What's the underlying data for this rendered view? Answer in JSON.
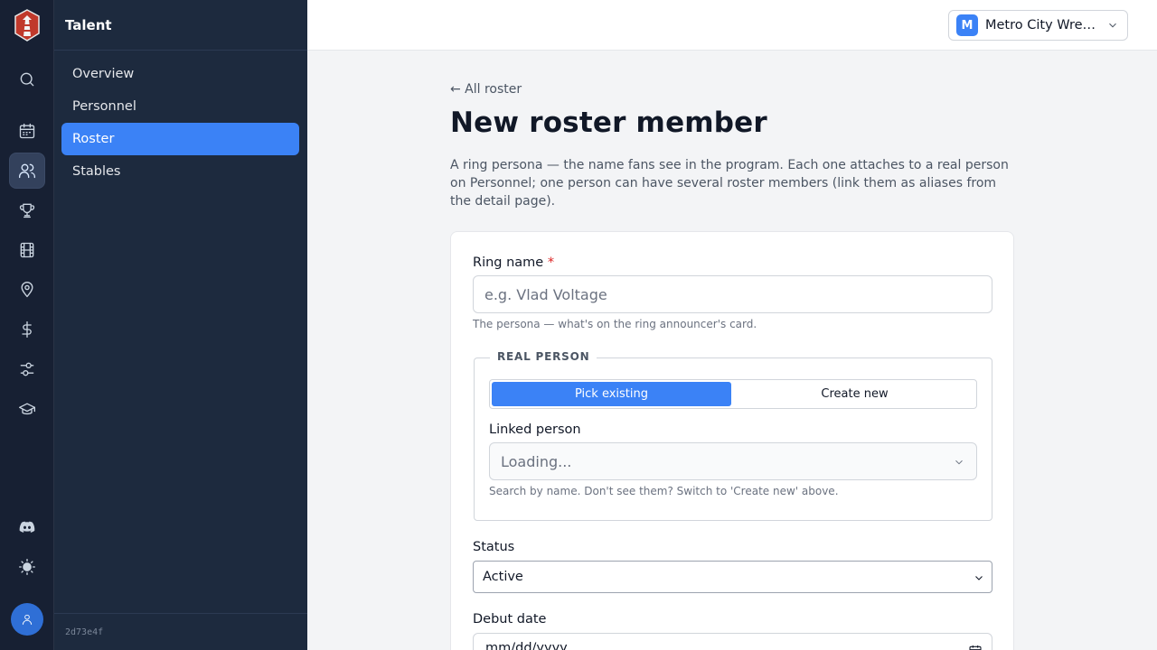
{
  "rail": {
    "logo_icon": "lighthouse-logo",
    "items": [
      {
        "icon": "search-icon",
        "active": false
      },
      {
        "icon": "calendar-icon",
        "active": false
      },
      {
        "icon": "users-icon",
        "active": true
      },
      {
        "icon": "trophy-icon",
        "active": false
      },
      {
        "icon": "film-icon",
        "active": false
      },
      {
        "icon": "map-pin-icon",
        "active": false
      },
      {
        "icon": "dollar-icon",
        "active": false
      },
      {
        "icon": "sliders-icon",
        "active": false
      },
      {
        "icon": "graduation-cap-icon",
        "active": false
      },
      {
        "icon": "discord-icon",
        "active": false
      },
      {
        "icon": "sun-icon",
        "active": false
      }
    ],
    "avatar_icon": "user-icon"
  },
  "subnav": {
    "title": "Talent",
    "items": [
      {
        "label": "Overview",
        "active": false
      },
      {
        "label": "Personnel",
        "active": false
      },
      {
        "label": "Roster",
        "active": true
      },
      {
        "label": "Stables",
        "active": false
      }
    ],
    "build_hash": "2d73e4f"
  },
  "topbar": {
    "org_initial": "M",
    "org_name": "Metro City Wrestling",
    "accent": "#3b82f6"
  },
  "page": {
    "back_link": "← All roster",
    "title": "New roster member",
    "description": "A ring persona — the name fans see in the program. Each one attaches to a real person on Personnel; one person can have several roster members (link them as aliases from the detail page)."
  },
  "form": {
    "ring_name": {
      "label": "Ring name",
      "required_mark": "*",
      "placeholder": "e.g. Vlad Voltage",
      "value": "",
      "hint": "The persona — what's on the ring announcer's card."
    },
    "real_person": {
      "legend": "REAL PERSON",
      "modes": [
        "Pick existing",
        "Create new"
      ],
      "selected_mode": "Pick existing",
      "linked_person_label": "Linked person",
      "linked_person_value": "Loading...",
      "hint": "Search by name. Don't see them? Switch to 'Create new' above."
    },
    "status": {
      "label": "Status",
      "value": "Active"
    },
    "debut_date": {
      "label": "Debut date",
      "placeholder": "mm/dd/yyyy"
    }
  }
}
